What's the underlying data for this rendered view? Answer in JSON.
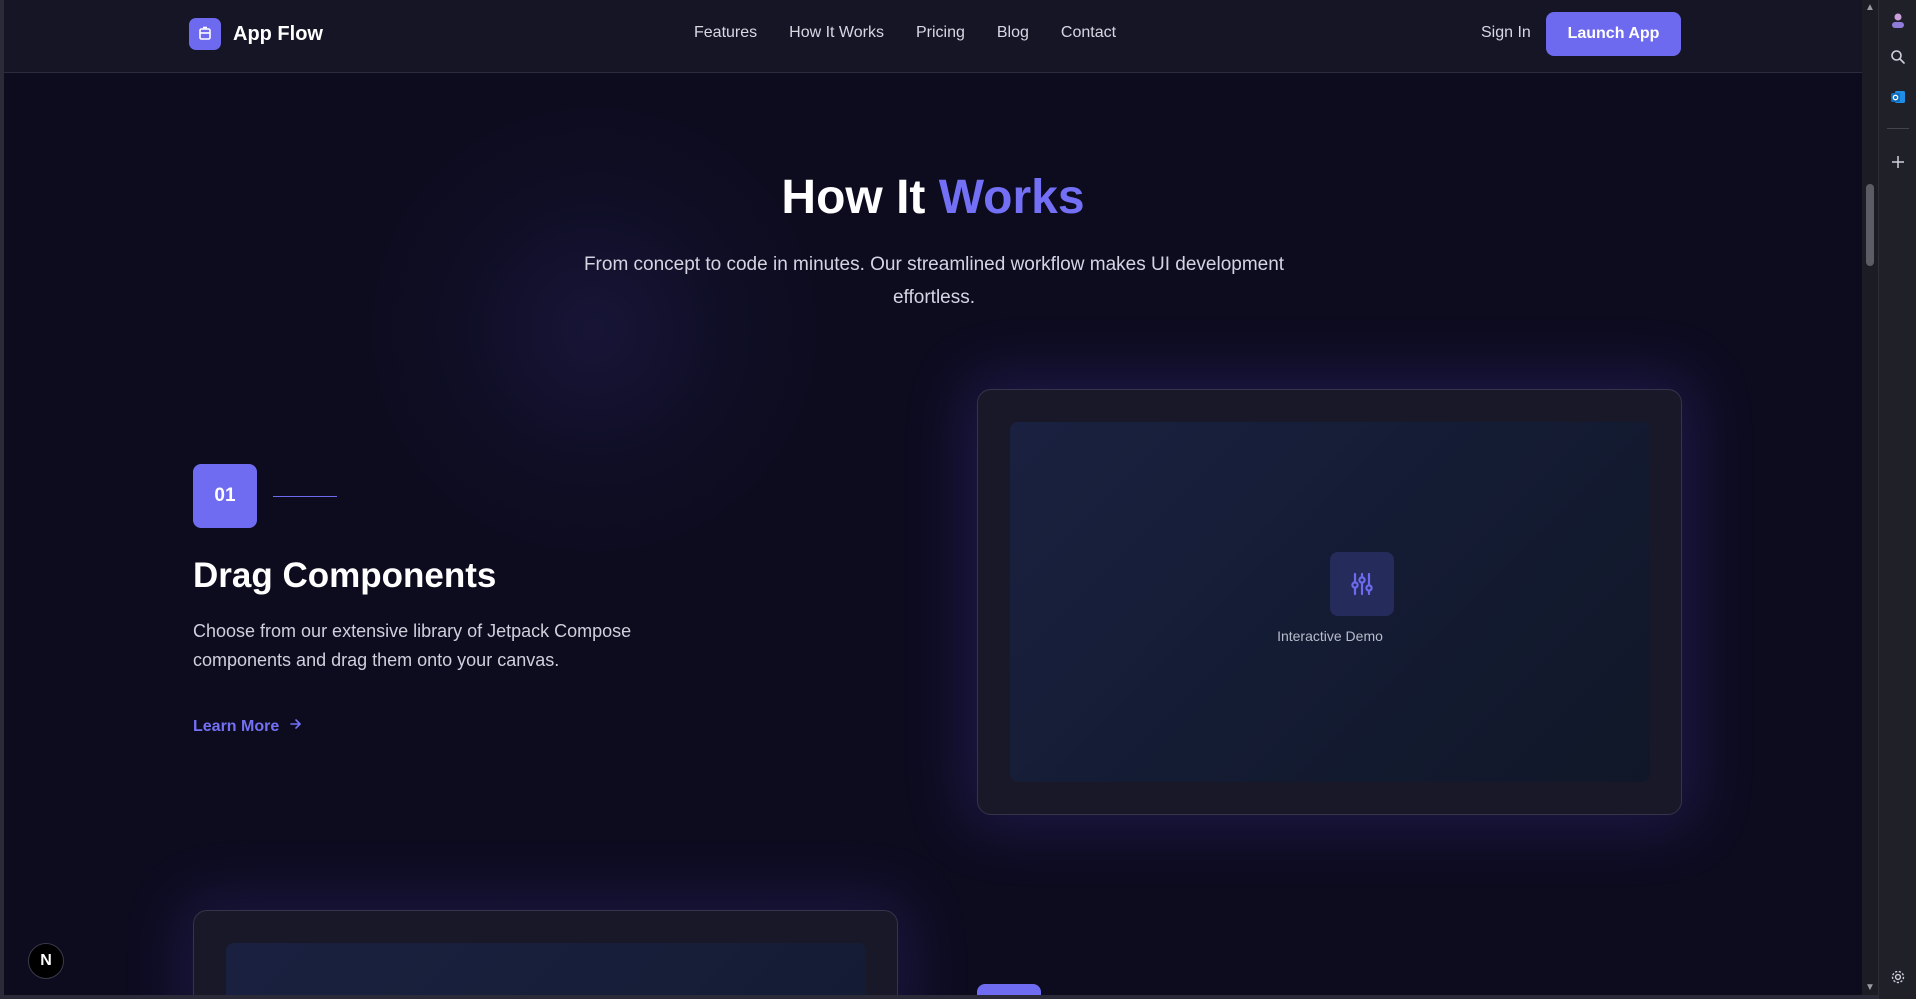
{
  "nav": {
    "logo_text": "App Flow",
    "links": [
      "Features",
      "How It Works",
      "Pricing",
      "Blog",
      "Contact"
    ],
    "sign_in": "Sign In",
    "launch": "Launch App"
  },
  "hero": {
    "title_main": "How It ",
    "title_accent": "Works",
    "subtitle": "From concept to code in minutes. Our streamlined workflow makes UI development effortless."
  },
  "step1": {
    "number": "01",
    "title": "Drag Components",
    "description": "Choose from our extensive library of Jetpack Compose components and drag them onto your canvas.",
    "link": "Learn More"
  },
  "demo": {
    "label": "Interactive Demo",
    "icon": "sliders-icon"
  },
  "framework_badge": "N",
  "colors": {
    "accent": "#6d6af0",
    "background": "#0d0c1f",
    "nav_bg": "#151526"
  }
}
